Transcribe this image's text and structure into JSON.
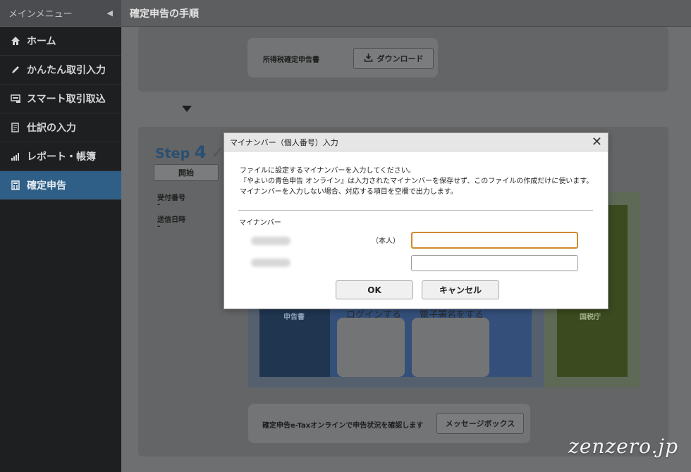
{
  "sidebar": {
    "header": "メインメニュー",
    "collapse_glyph": "◀",
    "items": [
      {
        "label": "ホーム"
      },
      {
        "label": "かんたん取引入力"
      },
      {
        "label": "スマート取引取込"
      },
      {
        "label": "仕訳の入力"
      },
      {
        "label": "レポート・帳簿"
      },
      {
        "label": "確定申告",
        "active": true
      }
    ]
  },
  "topbar": {
    "title": "確定申告の手順"
  },
  "background": {
    "doc_label": "所得税確定申告書",
    "download_button": "ダウンロード",
    "step_label": "Step",
    "step_number": "4",
    "start_button": "開始",
    "receipt_label": "受付番号",
    "receipt_value": "-",
    "sent_label": "送信日時",
    "sent_value": "-",
    "illus_doc": "申告書",
    "illus_login": "ログインする",
    "illus_sign": "電子署名をする",
    "illus_tax": "国税庁",
    "status_text": "確定申告e-Taxオンラインで申告状況を確認します",
    "message_button": "メッセージボックス"
  },
  "modal": {
    "title": "マイナンバー（個人番号）入力",
    "desc1": "ファイルに設定するマイナンバーを入力してください。",
    "desc2": "『やよいの青色申告 オンライン』は入力されたマイナンバーを保存せず、このファイルの作成だけに使います。",
    "desc3": "マイナンバーを入力しない場合、対応する項目を空欄で出力します。",
    "section_label": "マイナンバー",
    "self_label": "（本人）",
    "field1_value": "",
    "field2_value": "",
    "ok_label": "OK",
    "cancel_label": "キャンセル"
  },
  "watermark": "zenzero.jp",
  "colors": {
    "accent_active": "#2f5f86",
    "focus_border": "#d08a2e"
  }
}
